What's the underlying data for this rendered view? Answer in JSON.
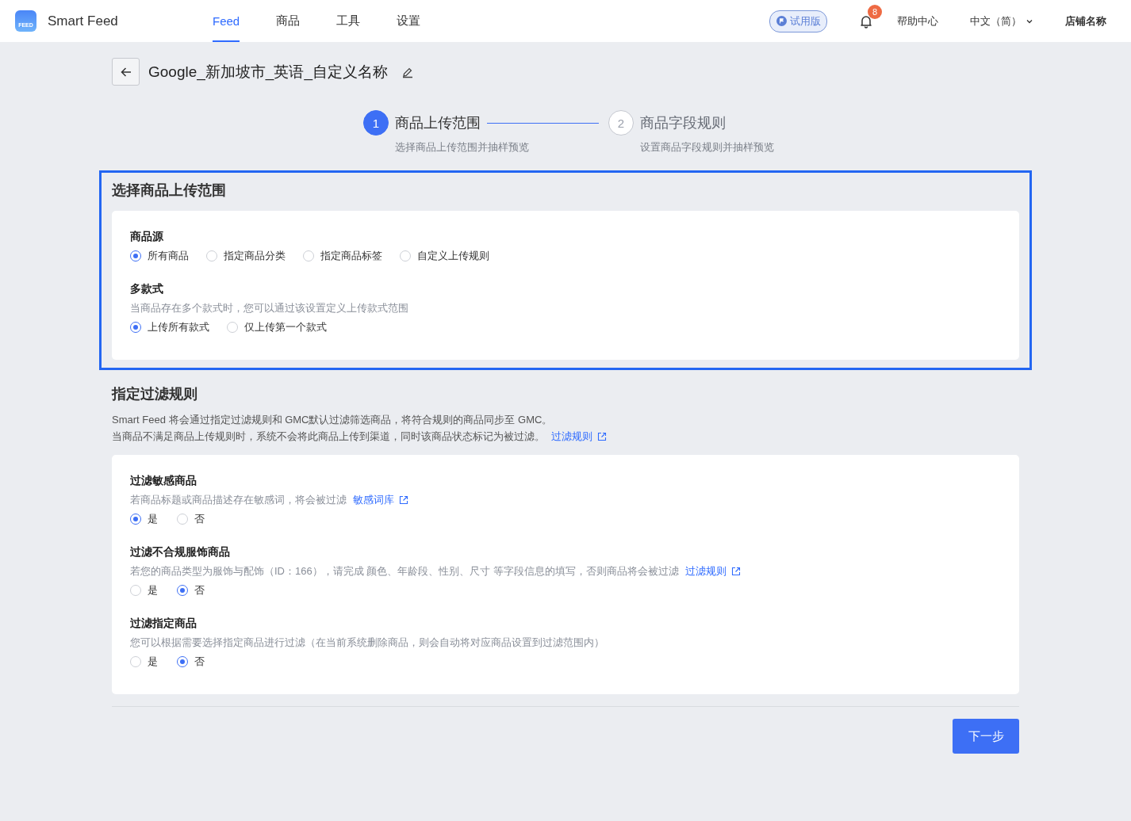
{
  "header": {
    "logo_text": "FEED",
    "app_name": "Smart Feed",
    "nav": [
      {
        "label": "Feed",
        "selected": true
      },
      {
        "label": "商品",
        "selected": false
      },
      {
        "label": "工具",
        "selected": false
      },
      {
        "label": "设置",
        "selected": false
      }
    ],
    "trial_badge": "试用版",
    "notification_count": "8",
    "help": "帮助中心",
    "language": "中文（简）",
    "store": "店铺名称"
  },
  "page_title": "Google_新加坡市_英语_自定义名称",
  "steps": [
    {
      "number": "1",
      "title": "商品上传范围",
      "subtitle": "选择商品上传范围并抽样预览",
      "active": true
    },
    {
      "number": "2",
      "title": "商品字段规则",
      "subtitle": "设置商品字段规则并抽样预览",
      "active": false
    }
  ],
  "scope_section": {
    "highlighted": true,
    "title": "选择商品上传范围",
    "groups": [
      {
        "title": "商品源",
        "options": [
          {
            "label": "所有商品",
            "selected": true
          },
          {
            "label": "指定商品分类",
            "selected": false
          },
          {
            "label": "指定商品标签",
            "selected": false
          },
          {
            "label": "自定义上传规则",
            "selected": false
          }
        ]
      },
      {
        "title": "多款式",
        "description": "当商品存在多个款式时，您可以通过该设置定义上传款式范围",
        "options": [
          {
            "label": "上传所有款式",
            "selected": true
          },
          {
            "label": "仅上传第一个款式",
            "selected": false
          }
        ]
      }
    ]
  },
  "filter_section": {
    "title": "指定过滤规则",
    "description_lines": [
      "Smart Feed 将会通过指定过滤规则和 GMC默认过滤筛选商品，将符合规则的商品同步至 GMC。",
      "当商品不满足商品上传规则时，系统不会将此商品上传到渠道，同时该商品状态标记为被过滤。"
    ],
    "link": "过滤规则",
    "groups": [
      {
        "title": "过滤敏感商品",
        "description": "若商品标题或商品描述存在敏感词，将会被过滤",
        "link": "敏感词库",
        "options": [
          {
            "label": "是",
            "selected": true
          },
          {
            "label": "否",
            "selected": false
          }
        ]
      },
      {
        "title": "过滤不合规服饰商品",
        "description": "若您的商品类型为服饰与配饰（ID：166），请完成 颜色、年龄段、性别、尺寸 等字段信息的填写，否则商品将会被过滤",
        "link": "过滤规则",
        "options": [
          {
            "label": "是",
            "selected": false
          },
          {
            "label": "否",
            "selected": true
          }
        ]
      },
      {
        "title": "过滤指定商品",
        "description": "您可以根据需要选择指定商品进行过滤（在当前系统删除商品，则会自动将对应商品设置到过滤范围内）",
        "options": [
          {
            "label": "是",
            "selected": false
          },
          {
            "label": "否",
            "selected": true
          }
        ]
      }
    ]
  },
  "next_button": "下一步"
}
